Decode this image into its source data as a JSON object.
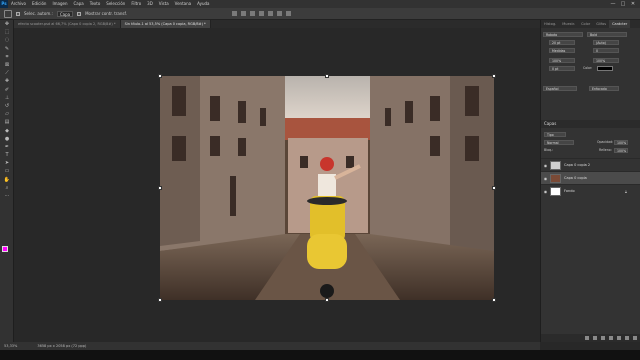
{
  "menubar": {
    "logo": "Ps",
    "items": [
      "Archivo",
      "Edición",
      "Imagen",
      "Capa",
      "Texto",
      "Selección",
      "Filtro",
      "3D",
      "Vista",
      "Ventana",
      "Ayuda"
    ],
    "window_controls": [
      "—",
      "□",
      "✕"
    ]
  },
  "options": {
    "auto_select_label": "Selec. autom.:",
    "auto_select_target": "Capa",
    "transform_controls_label": "Mostrar contr. transf."
  },
  "tabs": [
    {
      "label": "efecto scooter.psd al 66,7% (Capa 0 copia 2, RGB/8#) *"
    },
    {
      "label": "Sin título-1 al 53,5% (Capa 0 copia, RGB/8#) *"
    }
  ],
  "statusbar": {
    "zoom": "53,33%",
    "doc_size": "3658 px x 2058 px (72 ppp)"
  },
  "panels": {
    "top_tabs": [
      "Histog.",
      "Muestr.",
      "Color",
      "Glifos",
      "Carácter"
    ],
    "active_top_tab": "Carácter",
    "character": {
      "font": "Roboto",
      "style": "Bold",
      "size": "20 pt",
      "leading": "(Auto)",
      "kerning": "Medidas",
      "tracking": "0",
      "vscale": "100%",
      "hscale": "100%",
      "baseline": "0 pt",
      "color_label": "Color:",
      "language": "Español",
      "antialias": "Enfocado",
      "color": "#000000"
    },
    "layers": {
      "title": "Capas",
      "filter_kind": "Tipo",
      "blend_mode": "Normal",
      "opacity_label": "Opacidad:",
      "opacity": "100%",
      "lock_label": "Bloq.:",
      "fill_label": "Relleno:",
      "fill": "100%",
      "items": [
        {
          "name": "Capa 0 copia 2",
          "selected": false,
          "thumb": "#cfcfcf"
        },
        {
          "name": "Capa 0 copia",
          "selected": true,
          "thumb": "#7a4a36"
        },
        {
          "name": "Fondo",
          "selected": false,
          "thumb": "#ffffff",
          "locked": true
        }
      ]
    }
  },
  "tools": [
    "move",
    "marquee",
    "lasso",
    "quick-select",
    "crop",
    "frame",
    "eyedropper",
    "heal",
    "brush",
    "stamp",
    "history-brush",
    "eraser",
    "gradient",
    "blur",
    "dodge",
    "pen",
    "type",
    "path-select",
    "shape",
    "hand",
    "zoom",
    "more"
  ],
  "colors": {
    "foreground": "#ff00ff",
    "background": "#ffffff",
    "accent": "#31a8ff"
  }
}
